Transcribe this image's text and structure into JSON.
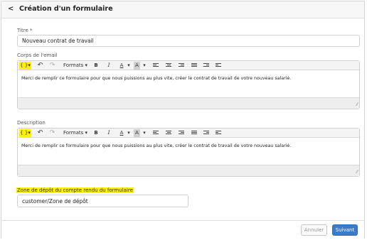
{
  "header": {
    "title": "Création d'un formulaire"
  },
  "form": {
    "title_label": "Titre *",
    "title_value": "Nouveau contrat de travail",
    "email_label": "Corps de l'email",
    "email_body": "Merci de remplir ce formulaire pour que nous puissions au plus vite, créer le contrat de travail de votre nouveau salarié.",
    "description_label": "Description",
    "description_body": "Merci de remplir ce formulaire pour que nous puissions au plus vite, créer le contrat de travail de votre nouveau salarié.",
    "deposit_label": "Zone de dépôt du compte rendu du formulaire",
    "deposit_value": "customer/Zone de dépôt"
  },
  "toolbar": {
    "variables": "{ }",
    "dropdown_caret": "▾",
    "undo": "↶",
    "redo": "↷",
    "formats": "Formats",
    "bold": "B",
    "italic": "I",
    "font_color": "A",
    "bg_color": "A"
  },
  "footer": {
    "cancel_label": "Annuler",
    "next_label": "Suivant"
  },
  "colors": {
    "highlight": "#fff200",
    "primary": "#3a7cc9"
  }
}
